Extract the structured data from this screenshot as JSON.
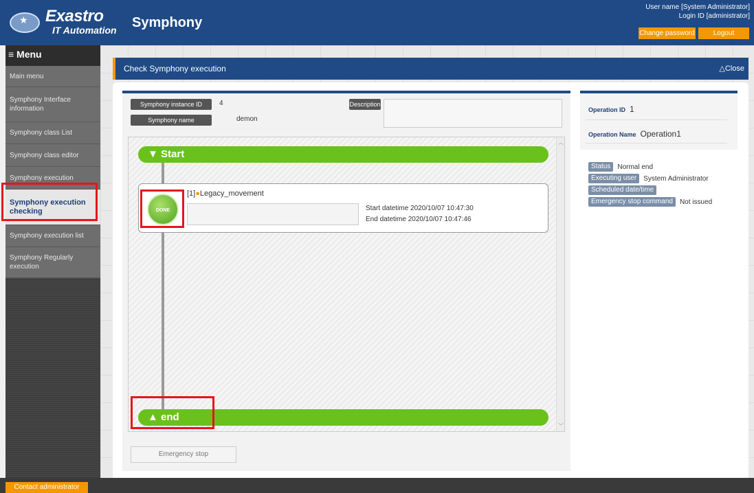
{
  "header": {
    "logo_main": "Exastro",
    "logo_sub": "IT Automation",
    "app_title": "Symphony",
    "user_name": "User name [System Administrator]",
    "login_id": "Login ID [administrator]",
    "change_password": "Change password",
    "logout": "Logout"
  },
  "sidebar": {
    "menu_title": "≡ Menu",
    "items": [
      {
        "label": "Main menu"
      },
      {
        "label": "Symphony Interface information"
      },
      {
        "label": "Symphony class List"
      },
      {
        "label": "Symphony class editor"
      },
      {
        "label": "Symphony execution"
      },
      {
        "label": "Symphony execution checking"
      },
      {
        "label": "Symphony execution list"
      },
      {
        "label": "Symphony Regularly execution"
      }
    ]
  },
  "section": {
    "title": "Check Symphony execution",
    "close": "△Close"
  },
  "info": {
    "instance_id_label": "Symphony instance ID",
    "instance_id": "4",
    "name_label": "Symphony name",
    "name": "demon",
    "description_label": "Description"
  },
  "flow": {
    "start": "▼ Start",
    "end": "▲ end",
    "node": {
      "status": "DONE",
      "index": "[1]",
      "dot": "●",
      "name": "Legacy_movement",
      "start_datetime": "Start datetime 2020/10/07 10:47:30",
      "end_datetime": "End datetime 2020/10/07 10:47:46"
    }
  },
  "emergency_stop": "Emergency stop",
  "operation": {
    "id_label": "Operation ID",
    "id": "1",
    "name_label": "Operation Name",
    "name": "Operation1"
  },
  "status": {
    "status_label": "Status",
    "status": "Normal end",
    "executing_user_label": "Executing user",
    "executing_user": "System Administrator",
    "scheduled_label": "Scheduled date/time",
    "estop_cmd_label": "Emergency stop command",
    "estop_cmd": "Not issued"
  },
  "footer": {
    "contact": "Contact administrator"
  },
  "colors": {
    "header_blue": "#1f4a85",
    "accent_orange": "#f39800",
    "flow_green": "#6bc11c",
    "highlight_red": "#e8141a"
  }
}
